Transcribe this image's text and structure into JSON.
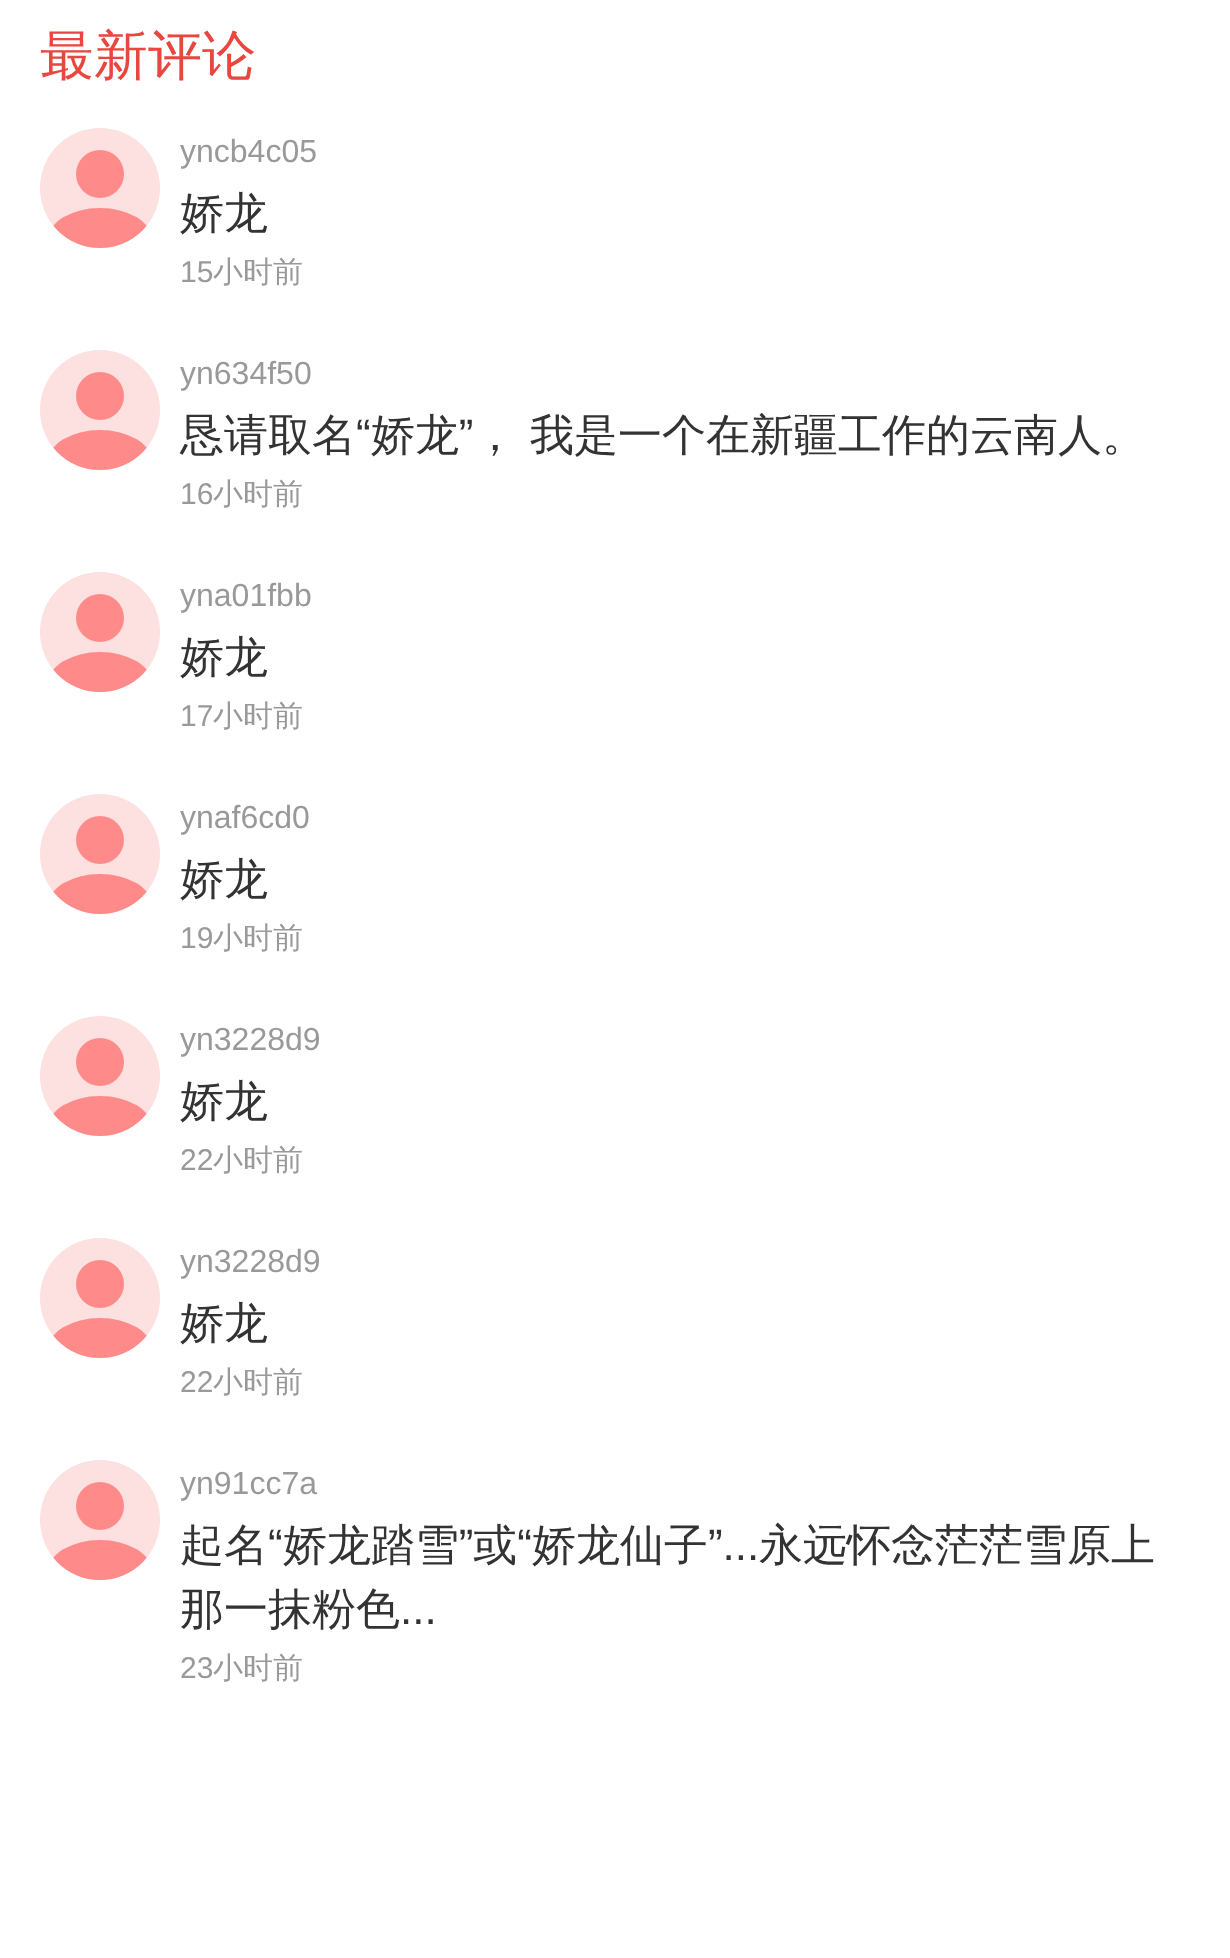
{
  "title": "最新评论",
  "comments": [
    {
      "user": "yncb4c05",
      "text": "娇龙",
      "time": "15小时前"
    },
    {
      "user": "yn634f50",
      "text": "恳请取名“娇龙”， 我是一个在新疆工作的云南人。",
      "time": "16小时前"
    },
    {
      "user": "yna01fbb",
      "text": "娇龙",
      "time": "17小时前"
    },
    {
      "user": "ynaf6cd0",
      "text": "娇龙",
      "time": "19小时前"
    },
    {
      "user": "yn3228d9",
      "text": "娇龙",
      "time": "22小时前"
    },
    {
      "user": "yn3228d9",
      "text": "娇龙",
      "time": "22小时前"
    },
    {
      "user": "yn91cc7a",
      "text": "起名“娇龙踏雪”或“娇龙仙子”...永远怀念茫茫雪原上那一抹粉色...",
      "time": "23小时前"
    }
  ]
}
